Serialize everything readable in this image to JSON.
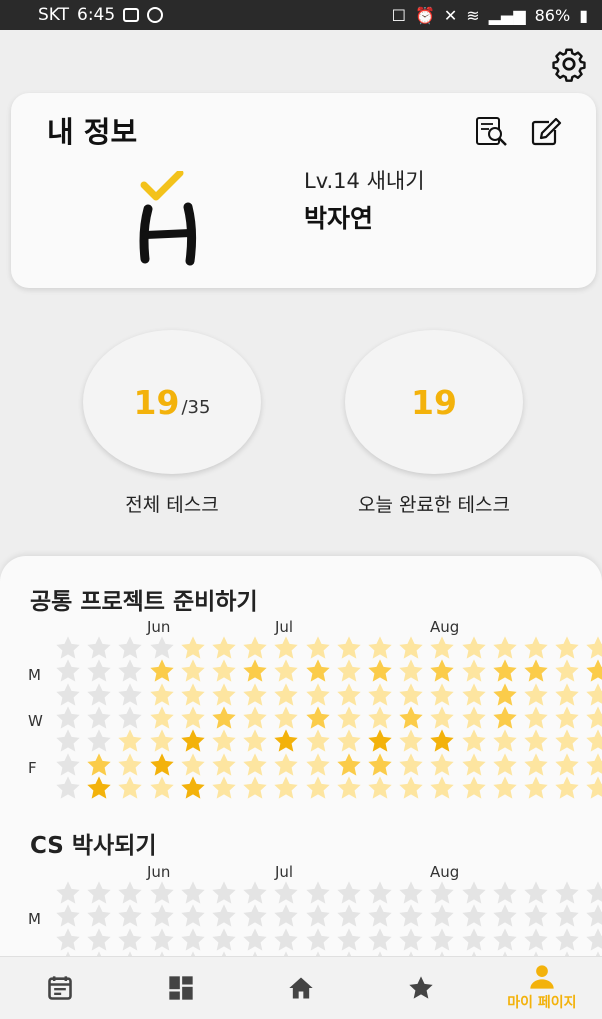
{
  "status": {
    "carrier": "SKT",
    "time": "6:45",
    "battery": "86%"
  },
  "profile": {
    "title": "내 정보",
    "level": "Lv.14  새내기",
    "name": "박자연"
  },
  "stats": [
    {
      "value": "19",
      "total": "/35",
      "label": "전체 테스크"
    },
    {
      "value": "19",
      "total": "",
      "label": "오늘 완료한 테스크"
    }
  ],
  "projects": [
    {
      "title": "공통 프로젝트 준비하기",
      "months": [
        "Jun",
        "Jul",
        "Aug"
      ],
      "days": [
        "M",
        "W",
        "F"
      ]
    },
    {
      "title": "CS 박사되기",
      "months": [
        "Jun",
        "Jul",
        "Aug"
      ],
      "days": [
        "M"
      ]
    }
  ],
  "grid1": [
    "0000111111111111111110",
    "0002112121212122123120",
    "0001111111111121111130",
    "0001121121121121111110",
    "0011311311313111111110",
    "0213111112211111111330",
    "0311311111111111111100"
  ],
  "grid2": [
    "0000000000000000000000",
    "0000000000000000000000",
    "0000000000000000000000",
    "0000000000000000000000"
  ],
  "colors": {
    "accent": "#f3b20b",
    "empty": "#e4e4e4",
    "light": "#fde5a0",
    "mid": "#fbcc4a",
    "dark": "#f3b20b"
  },
  "nav": {
    "active_label": "마이 페이지"
  }
}
